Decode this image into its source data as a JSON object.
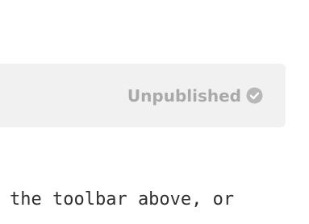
{
  "status": {
    "label": "Unpublished",
    "icon": "check-circle-icon",
    "color": "#a9a9a9"
  },
  "editor": {
    "text": "the toolbar above, or"
  }
}
